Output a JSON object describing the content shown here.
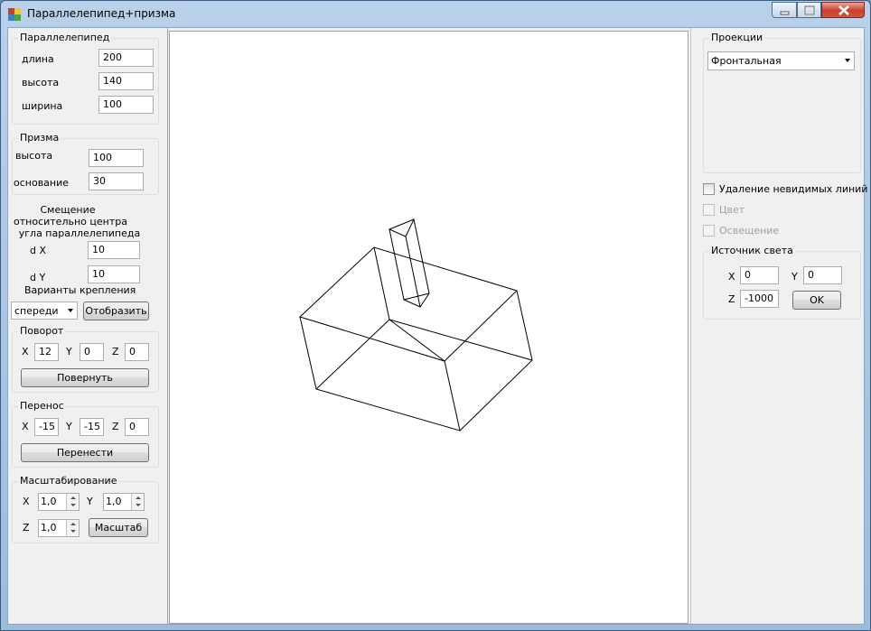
{
  "window": {
    "title": "Параллелепипед+призма"
  },
  "parallelepiped": {
    "title": "Параллелепипед",
    "length_label": "длина",
    "length": "200",
    "height_label": "высота",
    "height": "140",
    "width_label": "ширина",
    "width": "100"
  },
  "prism": {
    "title": "Призма",
    "height_label": "высота",
    "height": "100",
    "base_label": "основание",
    "base": "30"
  },
  "offset": {
    "caption_line1": "Смещение",
    "caption_line2": "относительно центра",
    "caption_line3": "угла параллелепипеда",
    "dx_label": "d X",
    "dx": "10",
    "dy_label": "d Y",
    "dy": "10",
    "mount_label": "Варианты крепления",
    "mount_value": "спереди",
    "show_button": "Отобразить"
  },
  "rotation": {
    "title": "Поворот",
    "x_label": "X",
    "x": "12",
    "y_label": "Y",
    "y": "0",
    "z_label": "Z",
    "z": "0",
    "button": "Повернуть"
  },
  "translation": {
    "title": "Перенос",
    "x_label": "X",
    "x": "-15",
    "y_label": "Y",
    "y": "-15",
    "z_label": "Z",
    "z": "0",
    "button": "Перенести"
  },
  "scaling": {
    "title": "Масштабирование",
    "x_label": "X",
    "x": "1,0",
    "y_label": "Y",
    "y": "1,0",
    "z_label": "Z",
    "z": "1,0",
    "button": "Масштаб"
  },
  "projections": {
    "title": "Проекции",
    "selected": "Фронтальная"
  },
  "options": {
    "hidden_lines": {
      "label": "Удаление невидимых линий",
      "checked": false,
      "enabled": true
    },
    "color": {
      "label": "Цвет",
      "checked": false,
      "enabled": false
    },
    "lighting": {
      "label": "Освещение",
      "checked": false,
      "enabled": false
    }
  },
  "light_source": {
    "title": "Источник света",
    "x_label": "X",
    "x": "0",
    "y_label": "Y",
    "y": "0",
    "z_label": "Z",
    "z": "-1000",
    "ok_button": "OK"
  },
  "icons": {
    "app": "app-icon",
    "minimize": "minimize-icon",
    "maximize": "maximize-icon",
    "close": "close-icon"
  },
  "colors": {
    "titlebar": "#b9d1ea",
    "close_button": "#c7402c",
    "panel": "#f0f0f0",
    "canvas": "#ffffff",
    "wireframe": "#000000"
  }
}
